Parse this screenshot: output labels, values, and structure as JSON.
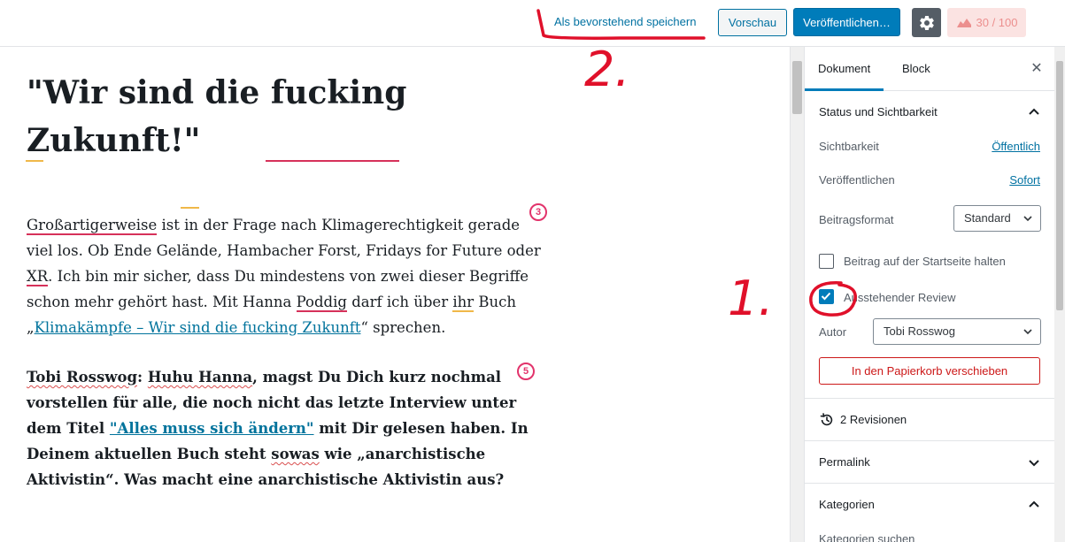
{
  "toolbar": {
    "save_pending_label": "Als bevorstehend speichern",
    "preview_label": "Vorschau",
    "publish_label": "Veröffentlichen…",
    "settings_icon": "gear-icon",
    "seo_score": "30 / 100",
    "score_icon": "seo-score-icon"
  },
  "post": {
    "title": "\"Wir sind die fucking Zukunft!\"",
    "p1_a": "Großartigerweise",
    "p1_b": " ist in der Frage nach Klimagerechtigkeit gerade viel los. Ob Ende Gelände, Hambacher Forst, Fridays for Future oder ",
    "p1_c": "XR",
    "p1_d": ". Ich bin mir sicher, dass Du mindestens von zwei dieser Begriffe schon mehr gehört hast. Mit Hanna ",
    "p1_e": "Poddig",
    "p1_f": " darf ich über ",
    "p1_g": "ihr",
    "p1_h": " Buch „",
    "p1_link": "Klimakämpfe – Wir sind die fucking Zukunft",
    "p1_i": "“ sprechen.",
    "p2_a": "Tobi Rosswog",
    "p2_b": ": ",
    "p2_c": "Huhu Hanna",
    "p2_d": ", magst Du Dich kurz nochmal vorstellen für alle, die noch nicht das letzte Interview unter dem Titel ",
    "p2_link": "\"Alles muss sich ändern\"",
    "p2_e": " mit Dir gelesen haben. In Deinem aktuellen Buch steht ",
    "p2_f": "sowas",
    "p2_g": " wie „anarchistische Aktivistin“. Was macht eine anarchistische Aktivistin aus?",
    "marker_3": "3",
    "marker_5": "5"
  },
  "sidebar": {
    "tab_document": "Dokument",
    "tab_block": "Block",
    "close": "✕",
    "status_heading": "Status und Sichtbarkeit",
    "visibility_label": "Sichtbarkeit",
    "visibility_value": "Öffentlich",
    "publish_label": "Veröffentlichen",
    "publish_value": "Sofort",
    "format_label": "Beitragsformat",
    "format_value": "Standard",
    "sticky_label": "Beitrag auf der Startseite halten",
    "sticky_checked": false,
    "pending_label": "Ausstehender Review",
    "pending_checked": true,
    "author_label": "Autor",
    "author_value": "Tobi Rosswog",
    "trash_label": "In den Papierkorb verschieben",
    "revisions_label": "2 Revisionen",
    "permalink_heading": "Permalink",
    "categories_heading": "Kategorien",
    "categories_search": "Kategorien suchen"
  },
  "annotations": {
    "label_1": "1.",
    "label_2": "2."
  },
  "colors": {
    "primary": "#007cba",
    "link": "#0071a1",
    "danger": "#cc1818",
    "annotation": "#e0102a",
    "score_bg": "#fbe3e2"
  }
}
